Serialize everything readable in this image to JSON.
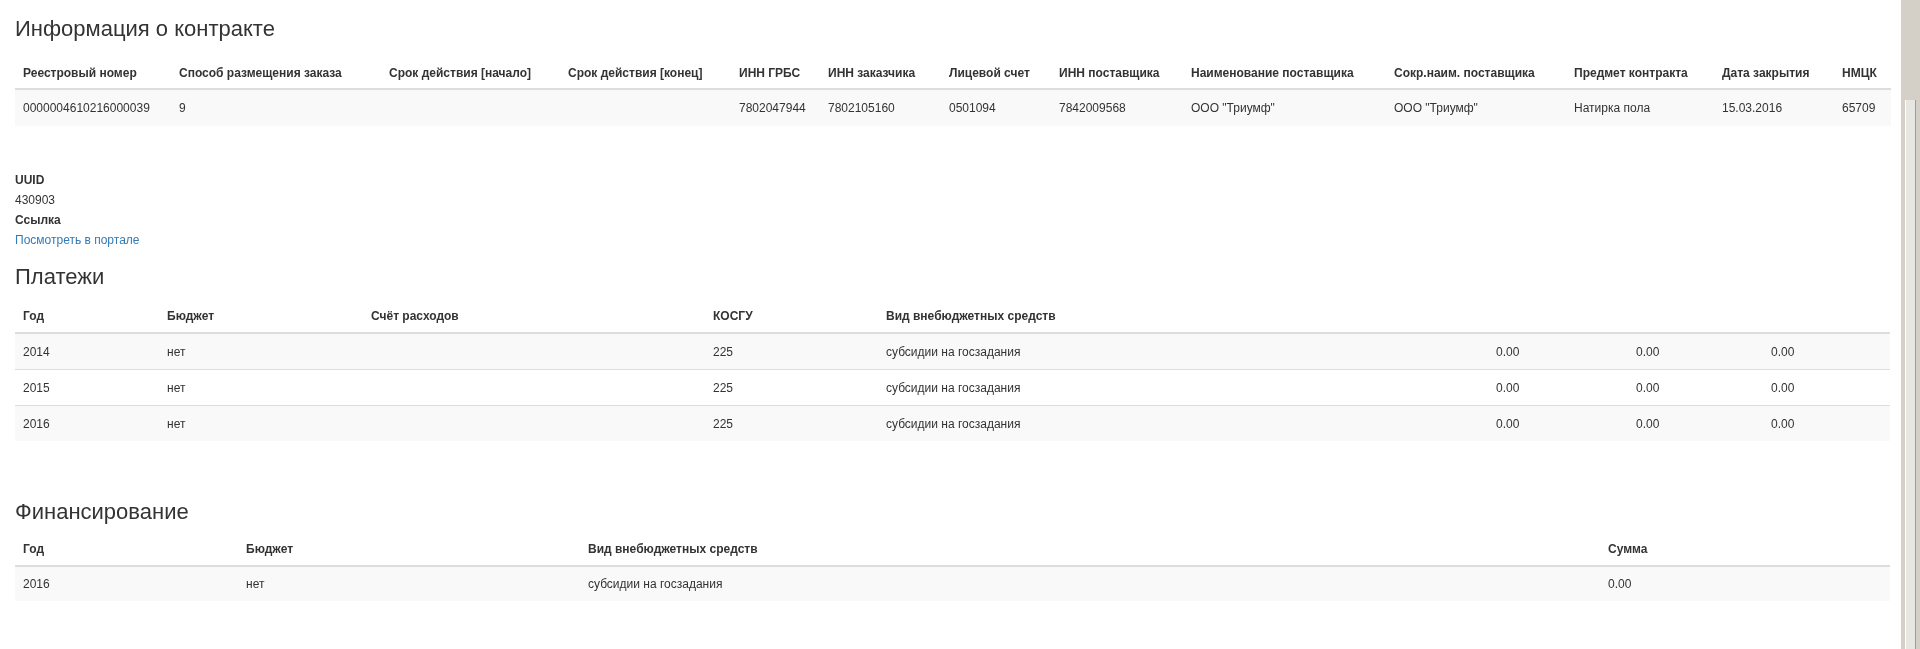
{
  "contract": {
    "title": "Информация о контракте",
    "columns": [
      "Реестровый номер",
      "Способ размещения заказа",
      "Срок действия [начало]",
      "Срок действия [конец]",
      "ИНН ГРБС",
      "ИНН заказчика",
      "Лицевой счет",
      "ИНН поставщика",
      "Наименование поставщика",
      "Сокр.наим. поставщика",
      "Предмет контракта",
      "Дата закрытия",
      "НМЦК"
    ],
    "rows": [
      [
        "0000004610216000039",
        "9",
        "",
        "",
        "7802047944",
        "7802105160",
        "0501094",
        "7842009568",
        "ООО \"Триумф\"",
        "ООО \"Триумф\"",
        "Натирка пола",
        "15.03.2016",
        "65709"
      ]
    ]
  },
  "details": [
    {
      "label": "UUID",
      "value": "430903",
      "kind": "text"
    },
    {
      "label": "Ссылка",
      "value": "Посмотреть в портале",
      "kind": "link"
    }
  ],
  "payments": {
    "title": "Платежи",
    "columns": [
      "Год",
      "Бюджет",
      "Счёт расходов",
      "КОСГУ",
      "Вид внебюджетных средств"
    ],
    "rows": [
      [
        "2014",
        "нет",
        "",
        "225",
        "субсидии на госзадания",
        "0.00",
        "0.00",
        "0.00"
      ],
      [
        "2015",
        "нет",
        "",
        "225",
        "субсидии на госзадания",
        "0.00",
        "0.00",
        "0.00"
      ],
      [
        "2016",
        "нет",
        "",
        "225",
        "субсидии на госзадания",
        "0.00",
        "0.00",
        "0.00"
      ]
    ]
  },
  "financing": {
    "title": "Финансирование",
    "columns": [
      "Год",
      "Бюджет",
      "Вид внебюджетных средств",
      "Сумма"
    ],
    "rows": [
      [
        "2016",
        "нет",
        "субсидии на госзадания",
        "0.00"
      ]
    ]
  }
}
